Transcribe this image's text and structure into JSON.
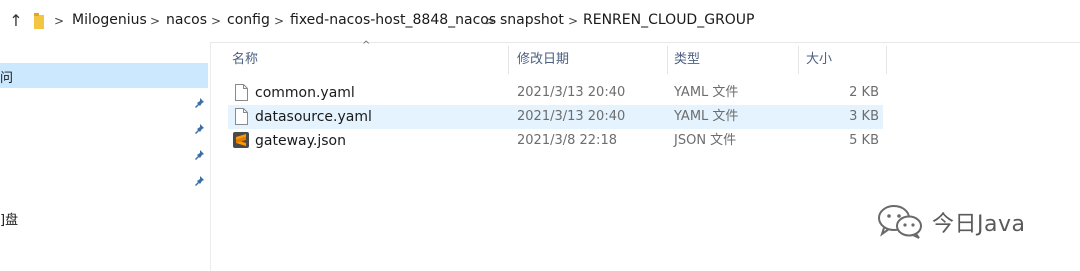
{
  "breadcrumb": [
    "Milogenius",
    "nacos",
    "config",
    "fixed-nacos-host_8848_nacos",
    "snapshot",
    "RENREN_CLOUD_GROUP"
  ],
  "nav": {
    "items": [
      "问",
      "]盘"
    ]
  },
  "columns": {
    "name": "名称",
    "date": "修改日期",
    "type": "类型",
    "size": "大小"
  },
  "files": [
    {
      "name": "common.yaml",
      "date": "2021/3/13 20:40",
      "type": "YAML 文件",
      "size": "2 KB",
      "icon": "document-icon"
    },
    {
      "name": "datasource.yaml",
      "date": "2021/3/13 20:40",
      "type": "YAML 文件",
      "size": "3 KB",
      "icon": "document-icon",
      "selected": true
    },
    {
      "name": "gateway.json",
      "date": "2021/3/8 22:18",
      "type": "JSON 文件",
      "size": "5 KB",
      "icon": "sublime-text-icon"
    }
  ],
  "watermark": "今日Java",
  "colors": {
    "selection": "#cce8ff",
    "hover_row": "#e5f3ff",
    "header_text": "#4d6082",
    "folder": "#f4c542"
  }
}
